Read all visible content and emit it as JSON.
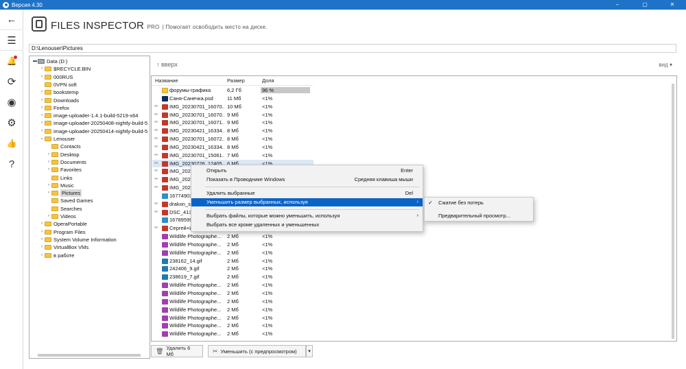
{
  "window": {
    "title": "Версия 4.30",
    "minimize": "–",
    "maximize": "▢",
    "close": "✕"
  },
  "brand": {
    "name": "FILES INSPECTOR",
    "edition": "PRO",
    "tagline": "| Помогает освободить место на диске."
  },
  "path": "D:\\Lenouser\\Pictures",
  "left_nav": [
    {
      "name": "back-icon",
      "glyph": "←"
    },
    {
      "name": "menu-icon",
      "glyph": "☰"
    },
    {
      "name": "bell-icon",
      "glyph": "🔔"
    },
    {
      "name": "refresh-icon",
      "glyph": "⟳"
    },
    {
      "name": "globe-icon",
      "glyph": "◉"
    },
    {
      "name": "gear-icon",
      "glyph": "⚙"
    },
    {
      "name": "thumbs-up-icon",
      "glyph": "👍"
    },
    {
      "name": "help-icon",
      "glyph": "?"
    }
  ],
  "tree": [
    {
      "label": "Data (D:)",
      "level": 0,
      "exp": "▬",
      "type": "drive"
    },
    {
      "label": "$RECYCLE.BIN",
      "level": 1,
      "exp": "›",
      "type": "folder"
    },
    {
      "label": "000RUS",
      "level": 1,
      "exp": "›",
      "type": "folder"
    },
    {
      "label": "0VPN soft",
      "level": 1,
      "exp": "",
      "type": "folder"
    },
    {
      "label": "bookstemp",
      "level": 1,
      "exp": "›",
      "type": "folder"
    },
    {
      "label": "Downloads",
      "level": 1,
      "exp": "›",
      "type": "folder"
    },
    {
      "label": "Firefox",
      "level": 1,
      "exp": "›",
      "type": "folder"
    },
    {
      "label": "image-uploader-1.4.1-build-5219-x64",
      "level": 1,
      "exp": "›",
      "type": "folder"
    },
    {
      "label": "image-uploader-20250408-nightly-build-5",
      "level": 1,
      "exp": "›",
      "type": "folder"
    },
    {
      "label": "image-uploader-20250414-nightly-build-5",
      "level": 1,
      "exp": "›",
      "type": "folder"
    },
    {
      "label": "Lenouser",
      "level": 1,
      "exp": "⌄",
      "type": "folder"
    },
    {
      "label": "Contacts",
      "level": 2,
      "exp": "",
      "type": "folder"
    },
    {
      "label": "Desktop",
      "level": 2,
      "exp": "›",
      "type": "folder"
    },
    {
      "label": "Documents",
      "level": 2,
      "exp": "›",
      "type": "folder"
    },
    {
      "label": "Favorites",
      "level": 2,
      "exp": "›",
      "type": "folder"
    },
    {
      "label": "Links",
      "level": 2,
      "exp": "",
      "type": "folder"
    },
    {
      "label": "Music",
      "level": 2,
      "exp": "›",
      "type": "folder"
    },
    {
      "label": "Pictures",
      "level": 2,
      "exp": "›",
      "type": "folder",
      "selected": true
    },
    {
      "label": "Saved Games",
      "level": 2,
      "exp": "",
      "type": "folder"
    },
    {
      "label": "Searches",
      "level": 2,
      "exp": "",
      "type": "folder"
    },
    {
      "label": "Videos",
      "level": 2,
      "exp": "›",
      "type": "folder"
    },
    {
      "label": "OperaPortable",
      "level": 1,
      "exp": "›",
      "type": "folder"
    },
    {
      "label": "Program Files",
      "level": 1,
      "exp": "›",
      "type": "folder"
    },
    {
      "label": "System Volume Information",
      "level": 1,
      "exp": "›",
      "type": "folder"
    },
    {
      "label": "VirtualBox VMs",
      "level": 1,
      "exp": "›",
      "type": "folder"
    },
    {
      "label": "в работе",
      "level": 1,
      "exp": "›",
      "type": "folder"
    }
  ],
  "list": {
    "up_label": "↑ вверх",
    "view_label": "вид ▾",
    "columns": {
      "name": "Название",
      "size": "Размер",
      "share": "Доля"
    },
    "rows": [
      {
        "name": "форумы-графика",
        "size": "6,2 Гб",
        "share": "96 %",
        "type": "folder",
        "mark": ""
      },
      {
        "name": "Саня-Санечка.psd",
        "size": "11 Мб",
        "share": "<1%",
        "type": "psd",
        "mark": ""
      },
      {
        "name": "IMG_20230701_16070...",
        "size": "10 Мб",
        "share": "<1%",
        "type": "jpg",
        "mark": "✂"
      },
      {
        "name": "IMG_20230701_16070...",
        "size": "9 Мб",
        "share": "<1%",
        "type": "jpg",
        "mark": "✂"
      },
      {
        "name": "IMG_20230701_16071...",
        "size": "9 Мб",
        "share": "<1%",
        "type": "jpg",
        "mark": "✂"
      },
      {
        "name": "IMG_20230421_16334...",
        "size": "8 Мб",
        "share": "<1%",
        "type": "jpg",
        "mark": "✂"
      },
      {
        "name": "IMG_20230701_16072...",
        "size": "8 Мб",
        "share": "<1%",
        "type": "jpg",
        "mark": "✂"
      },
      {
        "name": "IMG_20230421_16334...",
        "size": "8 Мб",
        "share": "<1%",
        "type": "jpg",
        "mark": "✂"
      },
      {
        "name": "IMG_20230701_15061...",
        "size": "7 Мб",
        "share": "<1%",
        "type": "jpg",
        "mark": "✂"
      },
      {
        "name": "IMG_20230726_12405...",
        "size": "6 Мб",
        "share": "<1%",
        "type": "jpg",
        "mark": "✂",
        "highlight": true
      },
      {
        "name": "IMG_2023",
        "size": "",
        "share": "",
        "type": "jpg",
        "mark": "✂"
      },
      {
        "name": "IMG_2023",
        "size": "",
        "share": "",
        "type": "jpg",
        "mark": "✂"
      },
      {
        "name": "IMG_2023",
        "size": "",
        "share": "",
        "type": "jpg",
        "mark": "✂"
      },
      {
        "name": "16774903",
        "size": "",
        "share": "",
        "type": "png",
        "mark": ""
      },
      {
        "name": "drakon_s",
        "size": "",
        "share": "",
        "type": "jpg",
        "mark": "✂"
      },
      {
        "name": "DSC_4132",
        "size": "",
        "share": "",
        "type": "jpg",
        "mark": "✂"
      },
      {
        "name": "16789599",
        "size": "",
        "share": "",
        "type": "png",
        "mark": ""
      },
      {
        "name": "Сергей+Ирина+Свадь...",
        "size": "",
        "share": "",
        "type": "jpg",
        "mark": "✂"
      },
      {
        "name": "Wildlife Photographe...",
        "size": "2 Мб",
        "share": "<1%",
        "type": "img",
        "mark": ""
      },
      {
        "name": "Wildlife Photographe...",
        "size": "2 Мб",
        "share": "<1%",
        "type": "img",
        "mark": ""
      },
      {
        "name": "Wildlife Photographe...",
        "size": "2 Мб",
        "share": "<1%",
        "type": "img",
        "mark": ""
      },
      {
        "name": "238162_14.gif",
        "size": "2 Мб",
        "share": "<1%",
        "type": "gif",
        "mark": ""
      },
      {
        "name": "242406_9.gif",
        "size": "2 Мб",
        "share": "<1%",
        "type": "gif",
        "mark": ""
      },
      {
        "name": "238619_7.gif",
        "size": "2 Мб",
        "share": "<1%",
        "type": "gif",
        "mark": ""
      },
      {
        "name": "Wildlife Photographe...",
        "size": "2 Мб",
        "share": "<1%",
        "type": "img",
        "mark": ""
      },
      {
        "name": "Wildlife Photographe...",
        "size": "2 Мб",
        "share": "<1%",
        "type": "img",
        "mark": ""
      },
      {
        "name": "Wildlife Photographe...",
        "size": "2 Мб",
        "share": "<1%",
        "type": "img",
        "mark": ""
      },
      {
        "name": "Wildlife Photographe...",
        "size": "2 Мб",
        "share": "<1%",
        "type": "img",
        "mark": ""
      },
      {
        "name": "Wildlife Photographe...",
        "size": "2 Мб",
        "share": "<1%",
        "type": "img",
        "mark": ""
      },
      {
        "name": "Wildlife Photographe...",
        "size": "2 Мб",
        "share": "<1%",
        "type": "img",
        "mark": ""
      },
      {
        "name": "Wildlife Photographe...",
        "size": "2 Мб",
        "share": "<1%",
        "type": "img",
        "mark": ""
      }
    ]
  },
  "context_menu": {
    "items": [
      {
        "label": "Открыть",
        "shortcut": "Enter"
      },
      {
        "label": "Показать в Проводнике Windows",
        "shortcut": "Средняя клавиша мыши"
      },
      {
        "label": "Удалить выбранные",
        "shortcut": "Del"
      },
      {
        "label": "Уменьшить размер выбранных, используя",
        "shortcut": "",
        "submenu": true,
        "active": true
      },
      {
        "label": "Выбрать файлы, которые можно уменьшить, используя",
        "shortcut": "",
        "submenu": true
      },
      {
        "label": "Выбрать все кроме удаленных и уменьшенных",
        "shortcut": ""
      }
    ]
  },
  "submenu": {
    "items": [
      {
        "label": "Сжатие без потерь",
        "checked": true
      },
      {
        "label": "Предварительный просмотр...",
        "checked": false
      }
    ]
  },
  "bottom": {
    "delete_label": "Удалить 6 Мб",
    "shrink_label": "Уменьшить (с предпросмотром)",
    "dropdown_glyph": "▾"
  },
  "colors": {
    "titlebar": "#1e73c8",
    "menu_active": "#0a64c8",
    "row_highlight": "#dce8f5"
  }
}
